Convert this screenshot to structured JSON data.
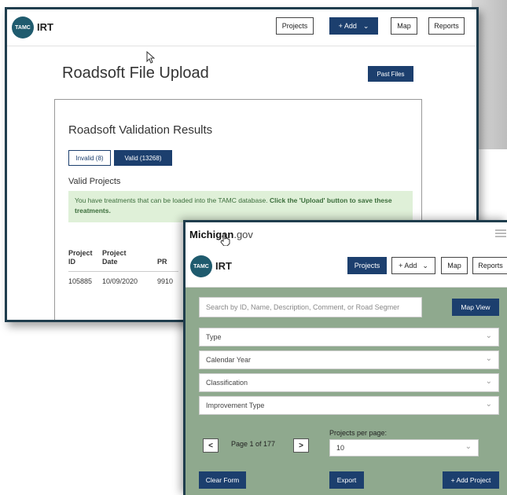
{
  "window1": {
    "header": {
      "logo_text": "TAMC",
      "brand": "IRT",
      "nav": {
        "projects": "Projects",
        "add": "+ Add",
        "map": "Map",
        "reports": "Reports"
      }
    },
    "page_title": "Roadsoft File Upload",
    "past_files_button": "Past Files",
    "panel": {
      "title": "Roadsoft Validation Results",
      "tab_invalid": "Invalid (8)",
      "tab_valid": "Valid (13268)",
      "subheading": "Valid Projects",
      "notice_text": "You have treatments that can be loaded into the TAMC database. ",
      "notice_bold": "Click the 'Upload' button to save these treatments.",
      "table": {
        "headers": [
          "Project ID",
          "Project Date",
          "PR"
        ],
        "rows": [
          [
            "105885",
            "10/09/2020",
            "9910"
          ]
        ]
      }
    }
  },
  "window2": {
    "site_bold": "Michigan",
    "site_rest": ".gov",
    "header": {
      "logo_text": "TAMC",
      "brand": "IRT",
      "nav": {
        "projects": "Projects",
        "add": "+ Add",
        "map": "Map",
        "reports": "Reports"
      }
    },
    "search_placeholder": "Search by ID, Name, Description, Comment, or Road Segmer",
    "map_view_button": "Map View",
    "filters": [
      "Type",
      "Calendar Year",
      "Classification",
      "Improvement Type"
    ],
    "pager": {
      "prev": "<",
      "next": ">",
      "page_text": "Page 1 of 177"
    },
    "per_page_label": "Projects per page:",
    "per_page_value": "10",
    "buttons": {
      "clear": "Clear Form",
      "export": "Export",
      "add_project": "+ Add Project"
    }
  }
}
